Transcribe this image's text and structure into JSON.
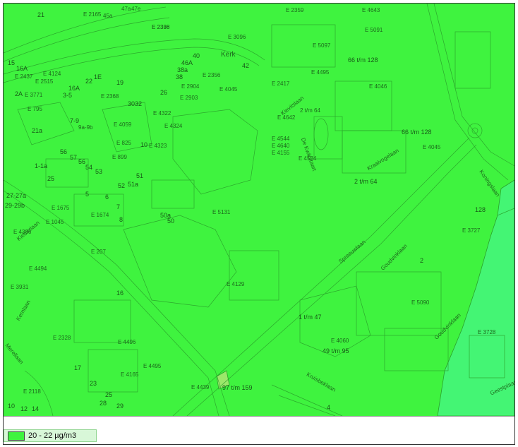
{
  "map": {
    "colors": {
      "zone_main": "#3ff33f",
      "zone_lower": "#44f574",
      "line": "#2aa12a",
      "label": "#1d6a1d"
    },
    "landmark_label": "Kerk",
    "streets": [
      "Spreeuwlaan",
      "Goudvinklaan",
      "Goudvinklaan",
      "Kraaivogelaan",
      "Kruisbeklaan",
      "De Kwikstaart",
      "Kievitslaan",
      "Koningslaan",
      "Kiebitzlaan",
      "Merellaan",
      "Kernlaan",
      "Geestplaan"
    ],
    "address_labels": [
      "21",
      "E 2165",
      "45a",
      "47a",
      "47e",
      "E 2398",
      "E 2359",
      "E 5097",
      "E 4643",
      "E 5091",
      "16A",
      "E 4124",
      "E 2437",
      "E 2515",
      "15",
      "1E",
      "19",
      "22",
      "E 2336",
      "E 3096",
      "40",
      "46A",
      "38a",
      "38",
      "Kerk",
      "42",
      "E 2356",
      "66 t/m 128",
      "E 2417",
      "E 4495",
      "16A",
      "3-5",
      "2A",
      "E 3771",
      "E 2904",
      "E 4045",
      "E 2368",
      "26",
      "E 2903",
      "E 4046",
      "E 795",
      "7-9",
      "9a-9b",
      "E 4059",
      "3032",
      "E 4322",
      "E 4324",
      "E 4642",
      "2 t/m 64",
      "E 4640",
      "21a",
      "E 825",
      "10",
      "E 4323",
      "E 4544",
      "66 t/m 128",
      "E 4045",
      "56",
      "57",
      "56",
      "54",
      "53",
      "E 899",
      "E 4155",
      "E 4534",
      "2 t/m 64",
      "1-1a",
      "25",
      "51",
      "52",
      "51a",
      "27-27a",
      "29-29b",
      "E 1675",
      "E 1674",
      "E 5131",
      "128",
      "E 4386",
      "E 1045",
      "5",
      "6",
      "7",
      "8",
      "50a",
      "50",
      "E 3727",
      "E 207",
      "2",
      "E 4494",
      "E 4129",
      "E 5090",
      "E 3931",
      "16",
      "1 t/m 47",
      "E 2328",
      "E 4060",
      "49 t/m 95",
      "E 3728",
      "17",
      "E 4496",
      "23",
      "E 4165",
      "E 4495",
      "E 4439",
      "97 t/m 159",
      "E 2118",
      "10",
      "12",
      "14",
      "25",
      "28",
      "29",
      "4"
    ]
  },
  "legend": {
    "swatch_color": "#3ff33f",
    "label": "20 - 22 µg/m3"
  }
}
